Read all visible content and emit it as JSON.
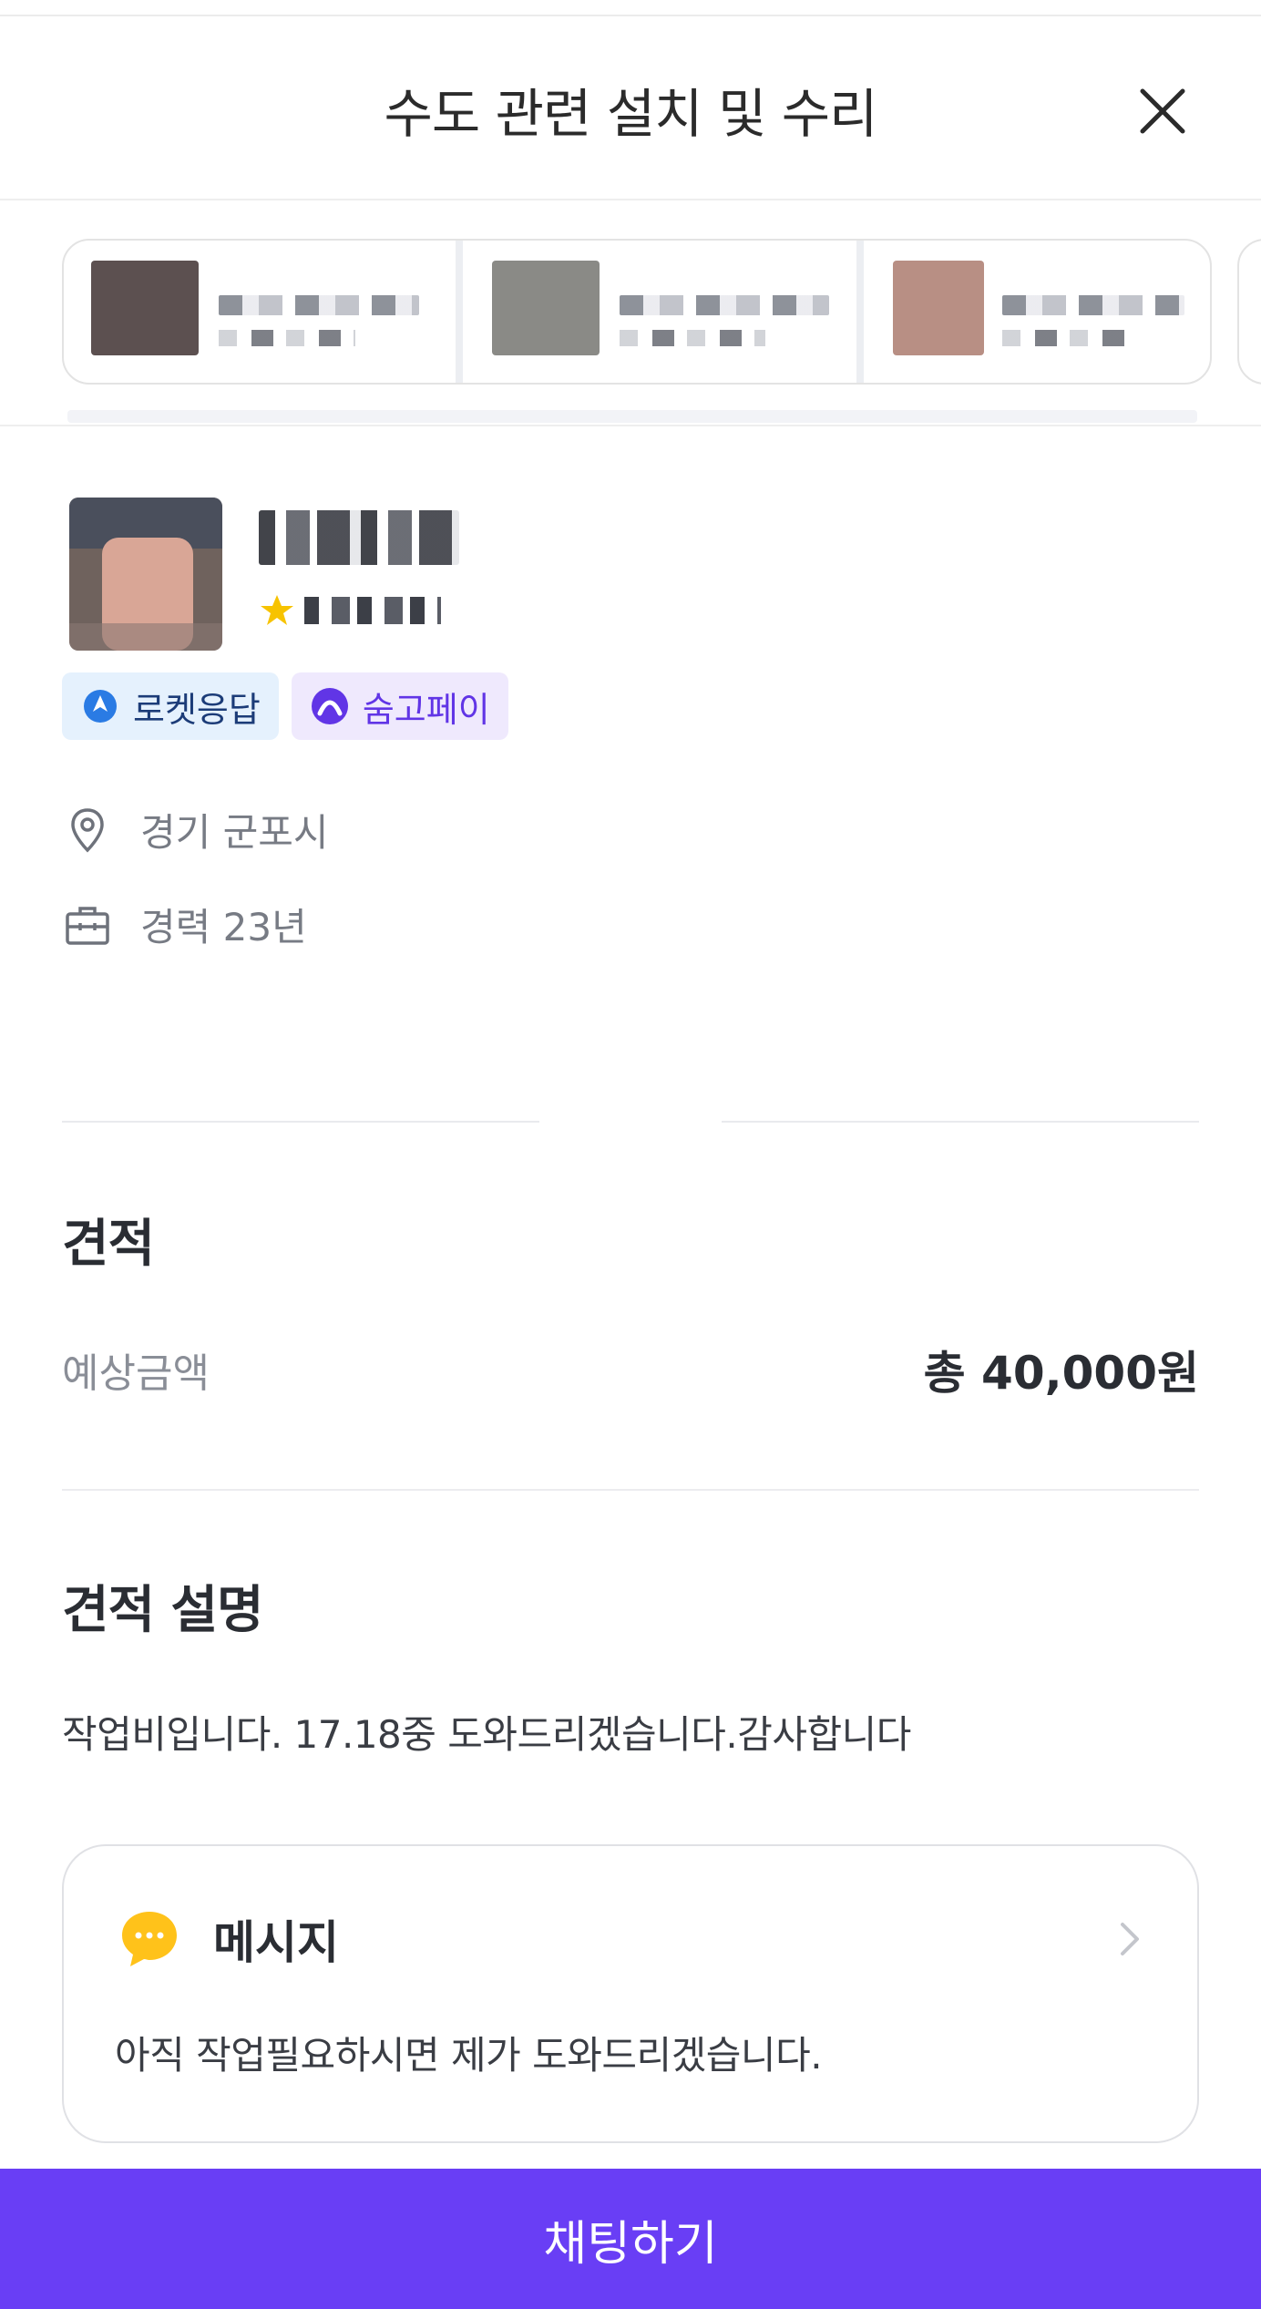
{
  "header": {
    "title": "수도 관련 설치 및 수리",
    "close_icon": "close-icon"
  },
  "carousel": {
    "cards": [
      {
        "thumb_color": "#6f625d"
      },
      {
        "thumb_color": "#8a8a86"
      },
      {
        "thumb_color": "#b88f84"
      }
    ]
  },
  "profile": {
    "badges": [
      {
        "label": "로켓응답",
        "icon": "rocket-icon",
        "color": "#1c3c78",
        "bg": "#e5f1fd"
      },
      {
        "label": "숨고페이",
        "icon": "soomgo-pay-icon",
        "color": "#6135e6",
        "bg": "#efe9fd"
      }
    ],
    "location": "경기 군포시",
    "career": "경력 23년",
    "star_color": "#f7c300"
  },
  "estimate": {
    "section_title": "견적",
    "label": "예상금액",
    "value": "총 40,000원"
  },
  "description": {
    "section_title": "견적 설명",
    "text": "작업비입니다. 17.18중 도와드리겠습니다.감사합니다"
  },
  "message": {
    "title": "메시지",
    "body": "아직 작업필요하시면 제가 도와드리겠습니다.",
    "icon_color": "#ffc21a"
  },
  "cta": {
    "label": "채팅하기",
    "color": "#693ef5"
  }
}
